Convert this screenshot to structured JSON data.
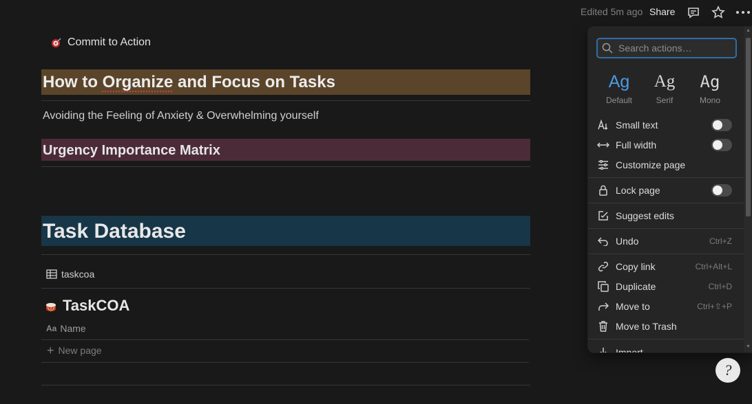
{
  "topbar": {
    "edited": "Edited 5m ago",
    "share": "Share",
    "icons": [
      "comment-icon",
      "star-icon",
      "more-icon"
    ]
  },
  "page": {
    "breadcrumb": "Commit to Action",
    "heading1": "How to Organize and Focus on Tasks",
    "subtext": "Avoiding the Feeling of Anxiety & Overwhelming yourself",
    "heading2": "Urgency Importance Matrix",
    "heading3": "Task Database",
    "db_link": "taskcoa",
    "db_title": "TaskCOA",
    "column_icon": "Aa",
    "column_name": "Name",
    "new_page": "New page",
    "colors": {
      "heading1_bg": "#5b452a",
      "heading2_bg": "#4c2b39",
      "heading3_bg": "#173648"
    }
  },
  "menu": {
    "search_placeholder": "Search actions…",
    "fonts": [
      {
        "glyph": "Ag",
        "label": "Default",
        "selected": true
      },
      {
        "glyph": "Ag",
        "label": "Serif",
        "selected": false
      },
      {
        "glyph": "Ag",
        "label": "Mono",
        "selected": false
      }
    ],
    "items": {
      "small_text": {
        "label": "Small text",
        "on": false
      },
      "full_width": {
        "label": "Full width",
        "on": false
      },
      "customize": {
        "label": "Customize page"
      },
      "lock": {
        "label": "Lock page",
        "on": false
      },
      "suggest": {
        "label": "Suggest edits"
      },
      "undo": {
        "label": "Undo",
        "shortcut": "Ctrl+Z"
      },
      "copy_link": {
        "label": "Copy link",
        "shortcut": "Ctrl+Alt+L"
      },
      "duplicate": {
        "label": "Duplicate",
        "shortcut": "Ctrl+D"
      },
      "move_to": {
        "label": "Move to",
        "shortcut": "Ctrl+⇧+P"
      },
      "trash": {
        "label": "Move to Trash"
      },
      "import": {
        "label": "Import"
      }
    }
  },
  "help": {
    "glyph": "?"
  }
}
